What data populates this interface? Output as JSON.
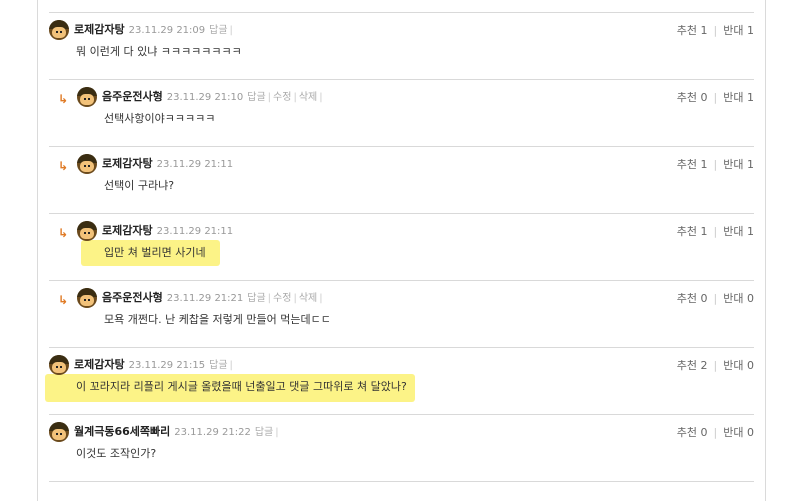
{
  "comments": [
    {
      "nick": "로제감자탕",
      "date": "23.11.29 21:09",
      "actions": [
        "답글"
      ],
      "body": "뭐 이런게 다 있냐 ㅋㅋㅋㅋㅋㅋㅋㅋ",
      "up_label": "추천 1",
      "down_label": "반대 1",
      "reply": false,
      "highlight": false
    },
    {
      "nick": "음주운전사형",
      "date": "23.11.29 21:10",
      "actions": [
        "답글",
        "수정",
        "삭제"
      ],
      "body": "선택사항이야ㅋㅋㅋㅋㅋ",
      "up_label": "추천 0",
      "down_label": "반대 1",
      "reply": true,
      "highlight": false
    },
    {
      "nick": "로제감자탕",
      "date": "23.11.29 21:11",
      "actions": [],
      "body": "선택이 구라냐?",
      "up_label": "추천 1",
      "down_label": "반대 1",
      "reply": true,
      "highlight": false
    },
    {
      "nick": "로제감자탕",
      "date": "23.11.29 21:11",
      "actions": [],
      "body": "입만 쳐 벌리면 사기네",
      "up_label": "추천 1",
      "down_label": "반대 1",
      "reply": true,
      "highlight": true
    },
    {
      "nick": "음주운전사형",
      "date": "23.11.29 21:21",
      "actions": [
        "답글",
        "수정",
        "삭제"
      ],
      "body": "모욕 개쩐다. 난 케찹을 저렇게 만들어 먹는데ㄷㄷ",
      "up_label": "추천 0",
      "down_label": "반대 0",
      "reply": true,
      "highlight": false
    },
    {
      "nick": "로제감자탕",
      "date": "23.11.29 21:15",
      "actions": [
        "답글"
      ],
      "body": "이 꼬라지라 리플리 게시글 올렸을때 넌출일고 댓글 그따위로 쳐 달았나?",
      "up_label": "추천 2",
      "down_label": "반대 0",
      "reply": false,
      "highlight": true
    },
    {
      "nick": "월계극동66세쪽빠리",
      "date": "23.11.29 21:22",
      "actions": [
        "답글"
      ],
      "body": "이것도 조작인가?",
      "up_label": "추천 0",
      "down_label": "반대 0",
      "reply": false,
      "highlight": false
    }
  ],
  "icons": {
    "reply_arrow": "reply-arrow-icon",
    "avatar": "avatar-icon"
  },
  "colors": {
    "highlight": "#fcf27a",
    "reply_arrow": "#e07b26",
    "divider": "#d9d9d9"
  }
}
